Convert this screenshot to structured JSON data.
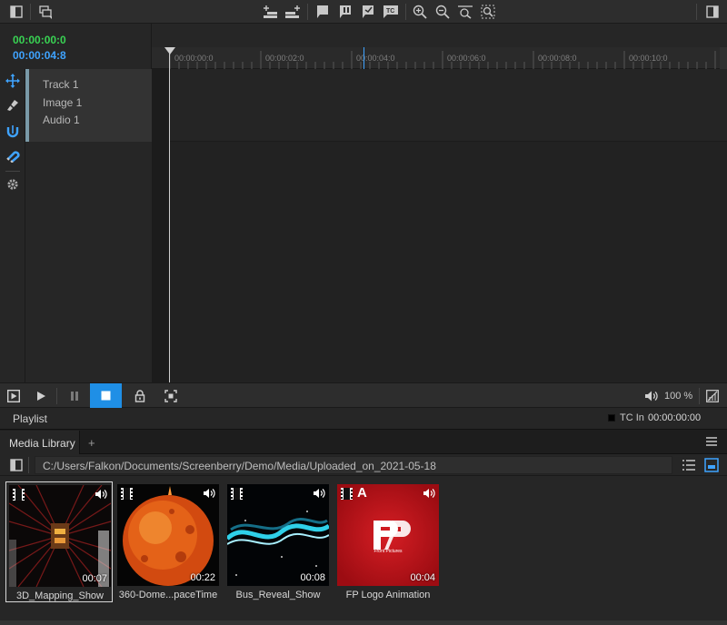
{
  "timecodes": {
    "current": "00:00:00:0",
    "duration": "00:00:04:8"
  },
  "tracks": [
    "Track 1",
    "Image 1",
    "Audio 1"
  ],
  "ruler_labels": [
    "00:00:00:0",
    "00:00:02:0",
    "00:00:04:0",
    "00:00:06:0",
    "00:00:08:0",
    "00:00:10:0"
  ],
  "transport": {
    "volume_percent": "100 %"
  },
  "playlist": {
    "label": "Playlist",
    "tc_in_label": "TC In",
    "tc_in_value": "00:00:00:00"
  },
  "media_library": {
    "tab_label": "Media Library",
    "add_tab": "+",
    "path": "C:/Users/Falkon/Documents/Screenberry/Demo/Media/Uploaded_on_2021-05-18",
    "items": [
      {
        "name": "3D_Mapping_Show",
        "duration": "00:07",
        "selected": true
      },
      {
        "name": "360-Dome...paceTime",
        "duration": "00:22",
        "selected": false
      },
      {
        "name": "Bus_Reveal_Show",
        "duration": "00:08",
        "selected": false
      },
      {
        "name": "FP Logo Animation",
        "duration": "00:04",
        "selected": false,
        "badge": "A",
        "logo_caption": "Front Pictures"
      }
    ]
  },
  "colors": {
    "accent_blue": "#1f8fe6",
    "timecode_green": "#39d353",
    "timecode_blue": "#3fa3ff"
  },
  "icons": {
    "topbar": [
      "panel-left-icon",
      "layers-icon",
      "add-track-icon",
      "add-layer-icon",
      "marker-icon",
      "pause-marker-icon",
      "check-marker-icon",
      "tc-marker-icon",
      "zoom-in-icon",
      "zoom-out-icon",
      "zoom-fit-icon",
      "zoom-selection-icon",
      "panel-right-icon"
    ],
    "tools": [
      "move-icon",
      "razor-icon",
      "snap-icon",
      "magnet-icon",
      "settings-icon"
    ],
    "transport": [
      "play-selection-icon",
      "play-icon",
      "pause-icon",
      "stop-icon",
      "lock-icon",
      "fullscreen-icon",
      "volume-icon",
      "scale-icon"
    ]
  }
}
